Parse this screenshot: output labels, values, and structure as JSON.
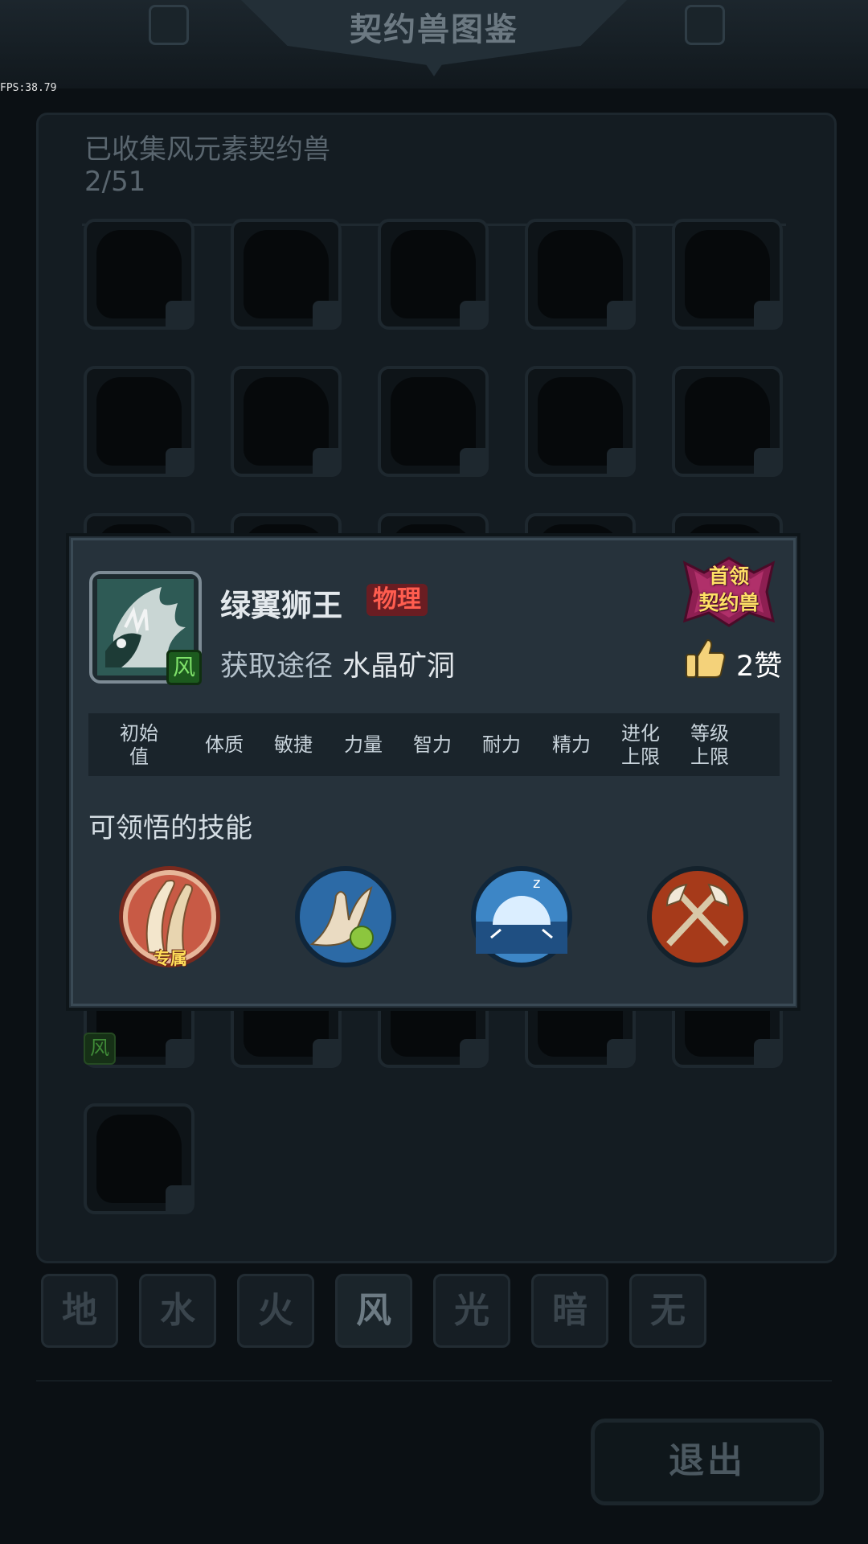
{
  "header": {
    "title": "契约兽图鉴",
    "fps": "FPS:38.79"
  },
  "collection": {
    "label": "已收集风元素契约兽",
    "count": "2/51",
    "visible_slot_badge": "风"
  },
  "element_tabs": [
    {
      "label": "地",
      "active": false
    },
    {
      "label": "水",
      "active": false
    },
    {
      "label": "火",
      "active": false
    },
    {
      "label": "风",
      "active": true
    },
    {
      "label": "光",
      "active": false
    },
    {
      "label": "暗",
      "active": false
    },
    {
      "label": "无",
      "active": false
    }
  ],
  "exit_label": "退出",
  "detail": {
    "name": "绿翼狮王",
    "type_tag": "物理",
    "element_badge": "风",
    "source_label": "获取途径",
    "source_value": "水晶矿洞",
    "boss_badge_line1": "首领",
    "boss_badge_line2": "契约兽",
    "like_count": "2赞",
    "stats_headers": [
      {
        "line1": "初始",
        "line2": "值"
      },
      {
        "line1": "体质",
        "line2": ""
      },
      {
        "line1": "敏捷",
        "line2": ""
      },
      {
        "line1": "力量",
        "line2": ""
      },
      {
        "line1": "智力",
        "line2": ""
      },
      {
        "line1": "耐力",
        "line2": ""
      },
      {
        "line1": "精力",
        "line2": ""
      },
      {
        "line1": "进化",
        "line2": "上限"
      },
      {
        "line1": "等级",
        "line2": "上限"
      }
    ],
    "skills_title": "可领悟的技能",
    "skills": [
      {
        "icon": "claw-slash-skill-icon",
        "tag": "专属",
        "colors": [
          "#b84a3a",
          "#f0dcc0"
        ]
      },
      {
        "icon": "wind-sprout-skill-icon",
        "tag": "",
        "colors": [
          "#1f5f9a",
          "#e6d2b0"
        ]
      },
      {
        "icon": "light-dome-skill-icon",
        "tag": "",
        "colors": [
          "#2e6fb0",
          "#d8ecff"
        ]
      },
      {
        "icon": "crossed-axes-skill-icon",
        "tag": "",
        "colors": [
          "#8a2a12",
          "#efe2cc"
        ]
      }
    ]
  }
}
